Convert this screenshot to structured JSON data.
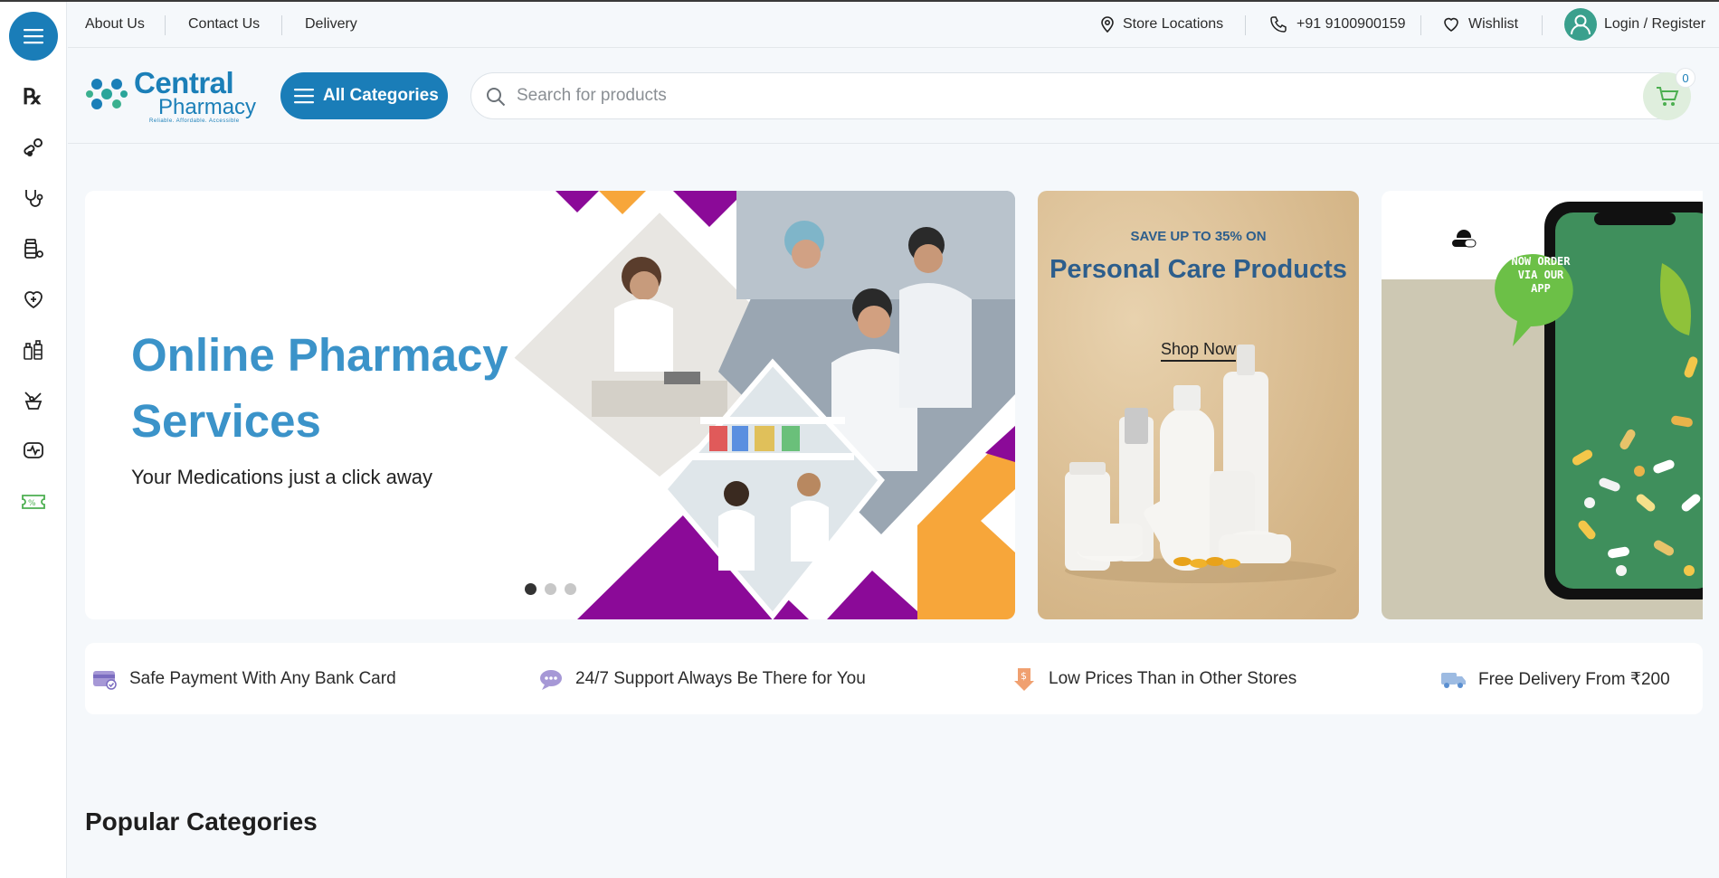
{
  "topbar": {
    "links": [
      "About Us",
      "Contact Us",
      "Delivery"
    ],
    "store_locations": "Store Locations",
    "phone": "+91 9100900159",
    "wishlist": "Wishlist",
    "login": "Login / Register"
  },
  "sidebar": {
    "icons": [
      "prescription-icon",
      "pills-icon",
      "stethoscope-icon",
      "medicine-bottle-icon",
      "heart-care-icon",
      "bottles-icon",
      "mortar-pestle-icon",
      "monitor-pulse-icon",
      "discount-ticket-icon"
    ]
  },
  "header": {
    "logo_title": "Central",
    "logo_subtitle": "Pharmacy",
    "logo_tagline": "Reliable. Affordable. Accessible",
    "all_categories": "All Categories",
    "search_placeholder": "Search for products",
    "cart_count": "0"
  },
  "hero": {
    "title": "Online Pharmacy Services",
    "subtitle": "Your Medications just a click away",
    "slides": 3,
    "active_slide": 1
  },
  "promo": {
    "kicker": "SAVE UP TO 35% ON",
    "title": "Personal Care Products",
    "link": "Shop Now"
  },
  "app_promo": {
    "badge": "NOW ORDER VIA OUR APP"
  },
  "features": [
    {
      "icon": "card-icon",
      "text": "Safe Payment With Any Bank Card"
    },
    {
      "icon": "support-chat-icon",
      "text": "24/7 Support Always Be There for You"
    },
    {
      "icon": "price-tag-icon",
      "text": "Low Prices Than in Other Stores"
    },
    {
      "icon": "delivery-truck-icon",
      "text": "Free Delivery From ₹200"
    }
  ],
  "sections": {
    "popular_categories": "Popular Categories"
  },
  "colors": {
    "brand_blue": "#1a7db8",
    "hero_title": "#3b93c9",
    "promo_text": "#2d5e8c",
    "purple": "#8b0a98",
    "orange": "#f7a63a",
    "app_green": "#6cc047"
  }
}
